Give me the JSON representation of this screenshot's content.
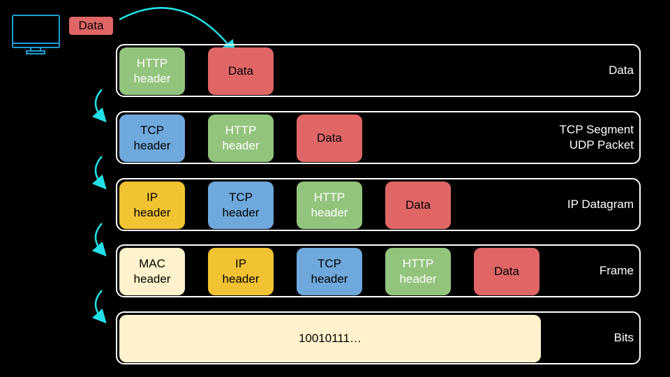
{
  "colors": {
    "http": "#93c47d",
    "data": "#e06666",
    "tcp": "#6fa8dc",
    "ip": "#f1c232",
    "mac": "#fff2cc",
    "bits": "#fff2cc",
    "arrow": "#22e0e8",
    "computer": "#1e9fd6"
  },
  "icons": {
    "computer": "desktop-monitor-icon"
  },
  "source_data_label": "Data",
  "rows": [
    {
      "label": "Data",
      "blocks": [
        {
          "text": "HTTP\nheader",
          "type": "http"
        },
        {
          "text": "Data",
          "type": "data"
        }
      ]
    },
    {
      "label": "TCP Segment\nUDP Packet",
      "blocks": [
        {
          "text": "TCP\nheader",
          "type": "tcp"
        },
        {
          "text": "HTTP\nheader",
          "type": "http"
        },
        {
          "text": "Data",
          "type": "data"
        }
      ]
    },
    {
      "label": "IP Datagram",
      "blocks": [
        {
          "text": "IP\nheader",
          "type": "ip"
        },
        {
          "text": "TCP\nheader",
          "type": "tcp"
        },
        {
          "text": "HTTP\nheader",
          "type": "http"
        },
        {
          "text": "Data",
          "type": "data"
        }
      ]
    },
    {
      "label": "Frame",
      "blocks": [
        {
          "text": "MAC\nheader",
          "type": "mac"
        },
        {
          "text": "IP\nheader",
          "type": "ip"
        },
        {
          "text": "TCP\nheader",
          "type": "tcp"
        },
        {
          "text": "HTTP\nheader",
          "type": "http"
        },
        {
          "text": "Data",
          "type": "data"
        }
      ]
    },
    {
      "label": "Bits",
      "blocks": [
        {
          "text": "10010111…",
          "type": "bits"
        }
      ]
    }
  ]
}
